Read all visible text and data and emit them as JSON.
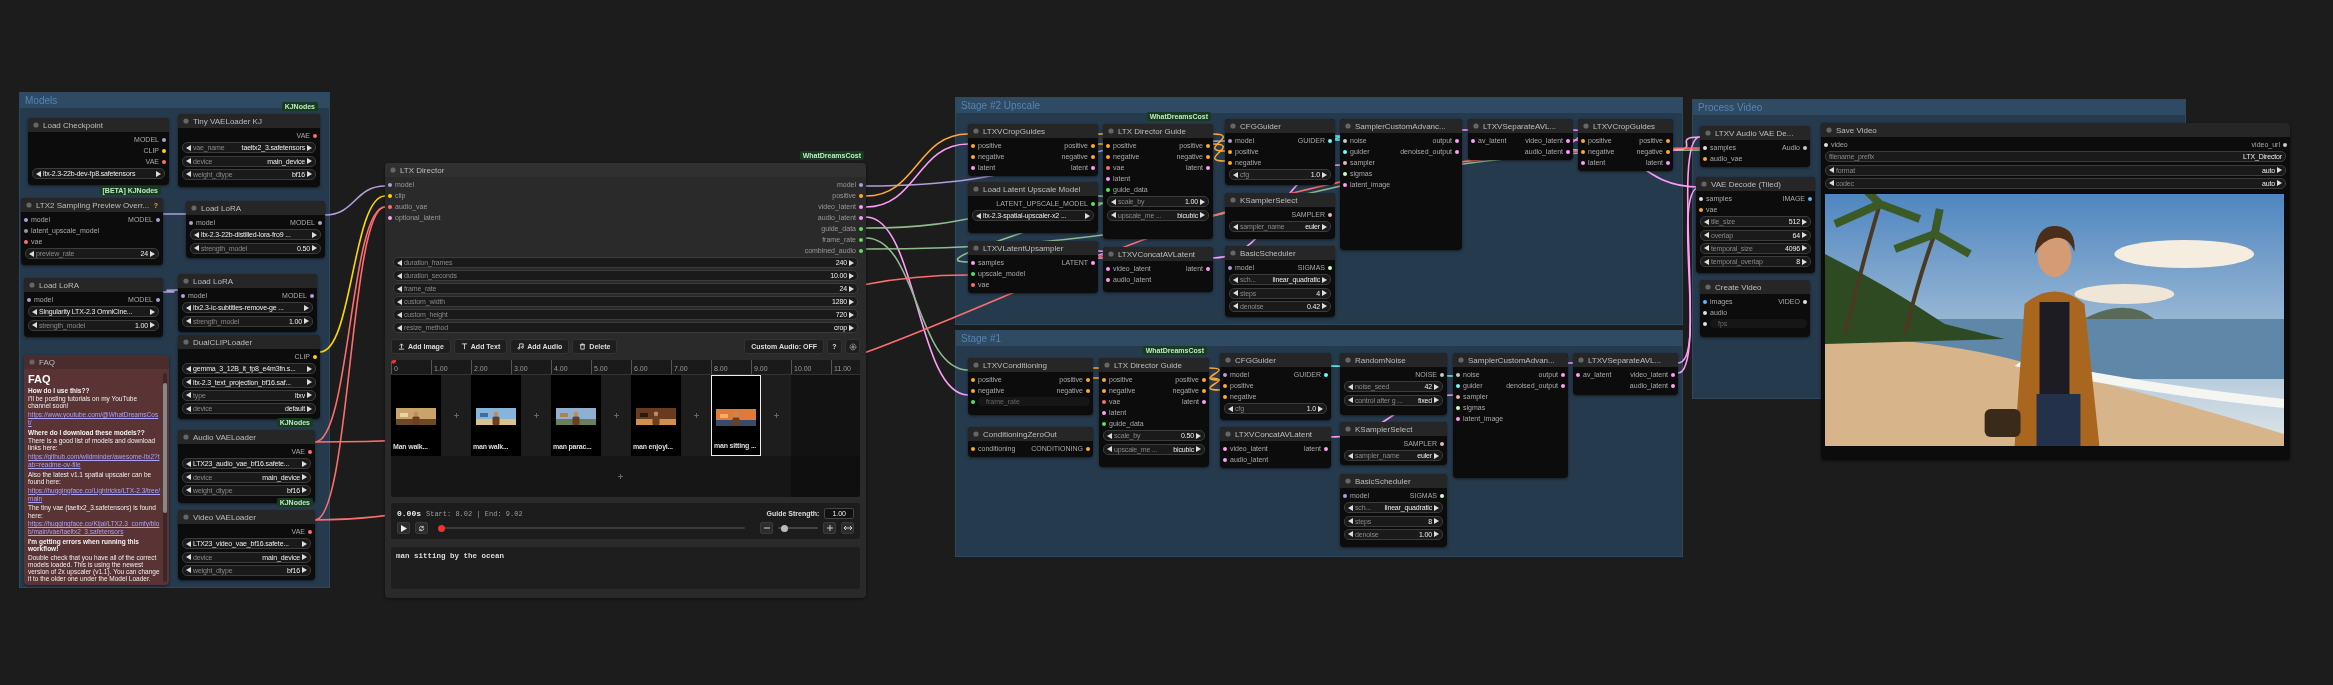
{
  "groups": [
    {
      "title": "Models"
    },
    {
      "title": "Stage #2 Upscale"
    },
    {
      "title": "Stage #1"
    },
    {
      "title": "Process Video"
    }
  ],
  "nodes": [
    {
      "kind": "standard",
      "title": "Load Checkpoint",
      "outputs": [
        {
          "name": "MODEL",
          "color": "#b39ddb"
        },
        {
          "name": "CLIP",
          "color": "#ffd500"
        },
        {
          "name": "VAE",
          "color": "#ff6e6e"
        }
      ],
      "widgets": [
        {
          "kind": "combo",
          "value": "ltx-2.3-22b-dev-fp8.safetensors"
        }
      ]
    },
    {
      "kind": "standard",
      "title": "Tiny VAELoader KJ",
      "badge": "KJNodes",
      "outputs": [
        {
          "name": "VAE",
          "color": "#ff6e6e"
        }
      ],
      "widgets": [
        {
          "kind": "combo",
          "label": "vae_name",
          "value": "taeltx2_3.safetensors"
        },
        {
          "kind": "combo",
          "label": "device",
          "value": "main_device"
        },
        {
          "kind": "combo",
          "label": "weight_dtype",
          "value": "bf16"
        }
      ]
    },
    {
      "kind": "standard",
      "title": "LTX2 Sampling Preview Overr...",
      "badge": "[BETA] KJNodes",
      "help": "?",
      "inputs": [
        {
          "name": "model",
          "color": "#b39ddb"
        },
        {
          "name": "latent_upscale_model",
          "color": "#9a9a9a"
        },
        {
          "name": "vae",
          "color": "#ff6e6e"
        }
      ],
      "outputs": [
        {
          "name": "MODEL",
          "color": "#b39ddb"
        }
      ],
      "widgets": [
        {
          "kind": "combo",
          "label": "preview_rate",
          "value": "24"
        }
      ]
    },
    {
      "kind": "standard",
      "title": "Load LoRA",
      "inputs": [
        {
          "name": "model",
          "color": "#b39ddb"
        }
      ],
      "outputs": [
        {
          "name": "MODEL",
          "color": "#b39ddb"
        }
      ],
      "widgets": [
        {
          "kind": "combo",
          "value": "ltx-2.3-22b-distilled-lora-fro9 ..."
        },
        {
          "kind": "combo",
          "label": "strength_model",
          "value": "0.50"
        }
      ]
    },
    {
      "kind": "standard",
      "title": "Load LoRA",
      "inputs": [
        {
          "name": "model",
          "color": "#b39ddb"
        }
      ],
      "outputs": [
        {
          "name": "MODEL",
          "color": "#b39ddb"
        }
      ],
      "widgets": [
        {
          "kind": "combo",
          "value": "Singularity LTX-2.3  OmniCine..."
        },
        {
          "kind": "combo",
          "label": "strength_model",
          "value": "1.00"
        }
      ]
    },
    {
      "kind": "standard",
      "title": "Load LoRA",
      "inputs": [
        {
          "name": "model",
          "color": "#b39ddb"
        }
      ],
      "outputs": [
        {
          "name": "MODEL",
          "color": "#b39ddb"
        }
      ],
      "widgets": [
        {
          "kind": "combo",
          "value": "ltx2.3-ic-subtitles-remove-ge ..."
        },
        {
          "kind": "combo",
          "label": "strength_model",
          "value": "1.00"
        }
      ]
    },
    {
      "kind": "note",
      "title": "FAQ",
      "paragraphs": [
        {
          "kind": "heading",
          "text": "FAQ"
        },
        {
          "kind": "question",
          "text": "How do I use this??"
        },
        {
          "kind": "text",
          "text": "I'll be posting tutorials on my YouTube channel soon!"
        },
        {
          "kind": "link",
          "text": "https://www.youtube.com/@WhatDreamsCost/"
        },
        {
          "kind": "question",
          "text": "Where do I download these models??"
        },
        {
          "kind": "text",
          "text": "There is a good list of models and download links here:"
        },
        {
          "kind": "link",
          "text": "https://github.com/wildminder/awesome-ltx2?tab=readme-ov-file"
        },
        {
          "kind": "text",
          "text": "Also the latest v1.1 spatial upscaler can be found here:"
        },
        {
          "kind": "link",
          "text": "https://huggingface.co/Lightricks/LTX-2.3/tree/main"
        },
        {
          "kind": "text",
          "text": "The tiny vae (taeltx2_3.safetensors) is found here:"
        },
        {
          "kind": "link",
          "text": "https://huggingface.co/Kijai/LTX2.3_comfy/blob/main/vae/taeltx2_3.safetensors"
        },
        {
          "kind": "question",
          "text": "I'm getting errors when running this workflow!"
        },
        {
          "kind": "text",
          "text": "Double check that you have all of the correct models loaded. This is using the newest version of 2x upscaler (v1.1). You can change it to the older one under the Model Loader."
        }
      ]
    },
    {
      "kind": "standard",
      "title": "DualCLIPLoader",
      "outputs": [
        {
          "name": "CLIP",
          "color": "#ffd500"
        }
      ],
      "widgets": [
        {
          "kind": "combo",
          "value": "gemma_3_12B_it_fp8_e4m3fn.s..."
        },
        {
          "kind": "combo",
          "value": "ltx-2.3_text_projection_bf16.saf..."
        },
        {
          "kind": "combo",
          "label": "type",
          "value": "ltxv"
        },
        {
          "kind": "combo",
          "label": "device",
          "value": "default"
        }
      ]
    },
    {
      "kind": "standard",
      "title": "Audio VAELoader",
      "badge": "KJNodes",
      "outputs": [
        {
          "name": "VAE",
          "color": "#ff6e6e"
        }
      ],
      "widgets": [
        {
          "kind": "combo",
          "value": "LTX23_audio_vae_bf16.safete..."
        },
        {
          "kind": "combo",
          "label": "device",
          "value": "main_device"
        },
        {
          "kind": "combo",
          "label": "weight_dtype",
          "value": "bf16"
        }
      ]
    },
    {
      "kind": "standard",
      "title": "Video VAELoader",
      "badge": "KJNodes",
      "outputs": [
        {
          "name": "VAE",
          "color": "#ff6e6e"
        }
      ],
      "widgets": [
        {
          "kind": "combo",
          "value": "LTX23_video_vae_bf16.safete..."
        },
        {
          "kind": "combo",
          "label": "device",
          "value": "main_device"
        },
        {
          "kind": "combo",
          "label": "weight_dtype",
          "value": "bf16"
        }
      ]
    },
    {
      "kind": "director",
      "title": "LTX Director",
      "badge": "WhatDreamsCost",
      "inputs": [
        {
          "name": "model",
          "color": "#b39ddb"
        },
        {
          "name": "clip",
          "color": "#ffd500"
        },
        {
          "name": "audio_vae",
          "color": "#ff6e6e"
        },
        {
          "name": "optional_latent",
          "color": "#ff9cf9"
        }
      ],
      "outputs": [
        {
          "name": "model",
          "color": "#b39ddb"
        },
        {
          "name": "positive",
          "color": "#ffa931"
        },
        {
          "name": "video_latent",
          "color": "#ff9cf9"
        },
        {
          "name": "audio_latent",
          "color": "#ff9cf9"
        },
        {
          "name": "guide_data",
          "color": "#5ee35e"
        },
        {
          "name": "frame_rate",
          "color": "#5ee35e"
        },
        {
          "name": "combined_audio",
          "color": "#5ee35e"
        }
      ],
      "widgets": [
        {
          "kind": "combo",
          "label": "duration_frames",
          "value": "240"
        },
        {
          "kind": "combo",
          "label": "duration_seconds",
          "value": "10.00"
        },
        {
          "kind": "combo",
          "label": "frame_rate",
          "value": "24"
        },
        {
          "kind": "combo",
          "label": "custom_width",
          "value": "1280"
        },
        {
          "kind": "combo",
          "label": "custom_height",
          "value": "720"
        },
        {
          "kind": "combo",
          "label": "resize_method",
          "value": "crop"
        }
      ],
      "toolbar": [
        {
          "kind": "upload",
          "label": "Add Image"
        },
        {
          "kind": "text",
          "label": "Add Text"
        },
        {
          "kind": "audio",
          "label": "Add Audio"
        },
        {
          "kind": "delete",
          "label": "Delete"
        }
      ],
      "toolbar_right": [
        {
          "kind": "toggle",
          "label": "Custom Audio: OFF"
        },
        {
          "kind": "help",
          "label": "?"
        },
        {
          "kind": "settings"
        }
      ],
      "ticks": [
        "0",
        "1.00",
        "2.00",
        "3.00",
        "4.00",
        "5.00",
        "6.00",
        "7.00",
        "8.00",
        "9.00",
        "10.00",
        "11.00"
      ],
      "clips": [
        {
          "caption": "Man walk...",
          "selected": false
        },
        {
          "caption": "man walk...",
          "selected": false
        },
        {
          "caption": "man parac...",
          "selected": false
        },
        {
          "caption": "man enjoyi...",
          "selected": false
        },
        {
          "caption": "man sitting ...",
          "selected": true
        }
      ],
      "time": "0.00s",
      "range": "Start: 8.02 | End: 9.02",
      "guide_label": "Guide Strength:",
      "guide_value": "1.00",
      "playhead": {
        "level": 0
      },
      "zoom": {
        "level": 0.15
      },
      "prompt": "man sitting by the ocean"
    },
    {
      "kind": "standard",
      "title": "LTXVCropGuides",
      "inputs": [
        {
          "name": "positive",
          "color": "#ffa931"
        },
        {
          "name": "negative",
          "color": "#ffa931"
        },
        {
          "name": "latent",
          "color": "#ff9cf9"
        }
      ],
      "outputs": [
        {
          "name": "positive",
          "color": "#ffa931"
        },
        {
          "name": "negative",
          "color": "#ffa931"
        },
        {
          "name": "latent",
          "color": "#ff9cf9"
        }
      ]
    },
    {
      "kind": "standard",
      "title": "LTX Director Guide",
      "badge": "WhatDreamsCost",
      "inputs": [
        {
          "name": "positive",
          "color": "#ffa931"
        },
        {
          "name": "negative",
          "color": "#ffa931"
        },
        {
          "name": "vae",
          "color": "#ff6e6e"
        },
        {
          "name": "latent",
          "color": "#ff9cf9"
        },
        {
          "name": "guide_data",
          "color": "#5ee35e"
        }
      ],
      "outputs": [
        {
          "name": "positive",
          "color": "#ffa931"
        },
        {
          "name": "negative",
          "color": "#ffa931"
        },
        {
          "name": "latent",
          "color": "#ff9cf9"
        }
      ],
      "widgets": [
        {
          "kind": "combo",
          "label": "scale_by",
          "value": "1.00"
        },
        {
          "kind": "combo",
          "label": "upscale_me ...",
          "value": "bicubic"
        }
      ]
    },
    {
      "kind": "standard",
      "title": "CFGGuider",
      "inputs": [
        {
          "name": "model",
          "color": "#b39ddb"
        },
        {
          "name": "positive",
          "color": "#ffa931"
        },
        {
          "name": "negative",
          "color": "#ffa931"
        }
      ],
      "outputs": [
        {
          "name": "GUIDER",
          "color": "#66ffff"
        }
      ],
      "widgets": [
        {
          "kind": "combo",
          "label": "cfg",
          "value": "1.0"
        }
      ]
    },
    {
      "kind": "standard",
      "title": "SamplerCustomAdvanc...",
      "inputs": [
        {
          "name": "noise",
          "color": "#c8c8c8"
        },
        {
          "name": "guider",
          "color": "#66ffff"
        },
        {
          "name": "sampler",
          "color": "#ecb4b4"
        },
        {
          "name": "sigmas",
          "color": "#cdffcd"
        },
        {
          "name": "latent_image",
          "color": "#ff9cf9"
        }
      ],
      "outputs": [
        {
          "name": "output",
          "color": "#ff9cf9"
        },
        {
          "name": "denoised_output",
          "color": "#ff9cf9"
        }
      ]
    },
    {
      "kind": "standard",
      "title": "LTXVSeparateAVL...",
      "inputs": [
        {
          "name": "av_latent",
          "color": "#ff9cf9"
        }
      ],
      "outputs": [
        {
          "name": "video_latent",
          "color": "#ff9cf9"
        },
        {
          "name": "audio_latent",
          "color": "#ff9cf9"
        }
      ]
    },
    {
      "kind": "standard",
      "title": "LTXVCropGuides",
      "inputs": [
        {
          "name": "positive",
          "color": "#ffa931"
        },
        {
          "name": "negative",
          "color": "#ffa931"
        },
        {
          "name": "latent",
          "color": "#ff9cf9"
        }
      ],
      "outputs": [
        {
          "name": "positive",
          "color": "#ffa931"
        },
        {
          "name": "negative",
          "color": "#ffa931"
        },
        {
          "name": "latent",
          "color": "#ff9cf9"
        }
      ]
    },
    {
      "kind": "standard",
      "title": "Load Latent Upscale Model",
      "outputs": [
        {
          "name": "LATENT_UPSCALE_MODEL",
          "color": "#5ee35e"
        }
      ],
      "widgets": [
        {
          "kind": "combo",
          "value": "ltx-2.3-spatial-upscaler-x2 ..."
        }
      ]
    },
    {
      "kind": "standard",
      "title": "KSamplerSelect",
      "outputs": [
        {
          "name": "SAMPLER",
          "color": "#ecb4b4"
        }
      ],
      "widgets": [
        {
          "kind": "combo",
          "label": "sampler_name",
          "value": "euler"
        }
      ]
    },
    {
      "kind": "standard",
      "title": "LTXVLatentUpsampler",
      "inputs": [
        {
          "name": "samples",
          "color": "#ff9cf9"
        },
        {
          "name": "upscale_model",
          "color": "#5ee35e"
        },
        {
          "name": "vae",
          "color": "#ff6e6e"
        }
      ],
      "outputs": [
        {
          "name": "LATENT",
          "color": "#ff9cf9"
        }
      ]
    },
    {
      "kind": "standard",
      "title": "LTXVConcatAVLatent",
      "inputs": [
        {
          "name": "video_latent",
          "color": "#ff9cf9"
        },
        {
          "name": "audio_latent",
          "color": "#ff9cf9"
        }
      ],
      "outputs": [
        {
          "name": "latent",
          "color": "#ff9cf9"
        }
      ]
    },
    {
      "kind": "standard",
      "title": "BasicScheduler",
      "inputs": [
        {
          "name": "model",
          "color": "#b39ddb"
        }
      ],
      "outputs": [
        {
          "name": "SIGMAS",
          "color": "#cdffcd"
        }
      ],
      "widgets": [
        {
          "kind": "combo",
          "label": "sch...",
          "value": "linear_quadratic"
        },
        {
          "kind": "combo",
          "label": "steps",
          "value": "4"
        },
        {
          "kind": "combo",
          "label": "denoise",
          "value": "0.42"
        }
      ]
    },
    {
      "kind": "standard",
      "title": "LTXVConditioning",
      "inputs": [
        {
          "name": "positive",
          "color": "#ffa931"
        },
        {
          "name": "negative",
          "color": "#ffa931"
        }
      ],
      "outputs": [
        {
          "name": "positive",
          "color": "#ffa931"
        },
        {
          "name": "negative",
          "color": "#ffa931"
        }
      ],
      "field_inputs": [
        {
          "name": "frame_rate",
          "color": "#5ee35e"
        }
      ]
    },
    {
      "kind": "standard",
      "title": "LTX Director Guide",
      "badge": "WhatDreamsCost",
      "inputs": [
        {
          "name": "positive",
          "color": "#ffa931"
        },
        {
          "name": "negative",
          "color": "#ffa931"
        },
        {
          "name": "vae",
          "color": "#ff6e6e"
        },
        {
          "name": "latent",
          "color": "#ff9cf9"
        },
        {
          "name": "guide_data",
          "color": "#5ee35e"
        }
      ],
      "outputs": [
        {
          "name": "positive",
          "color": "#ffa931"
        },
        {
          "name": "negative",
          "color": "#ffa931"
        },
        {
          "name": "latent",
          "color": "#ff9cf9"
        }
      ],
      "widgets": [
        {
          "kind": "combo",
          "label": "scale_by",
          "value": "0.50"
        },
        {
          "kind": "combo",
          "label": "upscale_me ...",
          "value": "bicubic"
        }
      ]
    },
    {
      "kind": "standard",
      "title": "CFGGuider",
      "inputs": [
        {
          "name": "model",
          "color": "#b39ddb"
        },
        {
          "name": "positive",
          "color": "#ffa931"
        },
        {
          "name": "negative",
          "color": "#ffa931"
        }
      ],
      "outputs": [
        {
          "name": "GUIDER",
          "color": "#66ffff"
        }
      ],
      "widgets": [
        {
          "kind": "combo",
          "label": "cfg",
          "value": "1.0"
        }
      ]
    },
    {
      "kind": "standard",
      "title": "RandomNoise",
      "outputs": [
        {
          "name": "NOISE",
          "color": "#c8c8c8"
        }
      ],
      "widgets": [
        {
          "kind": "combo",
          "label": "noise_seed",
          "value": "42"
        },
        {
          "kind": "combo",
          "label": "control after g ...",
          "value": "fixed"
        }
      ]
    },
    {
      "kind": "standard",
      "title": "SamplerCustomAdvan...",
      "inputs": [
        {
          "name": "noise",
          "color": "#c8c8c8"
        },
        {
          "name": "guider",
          "color": "#66ffff"
        },
        {
          "name": "sampler",
          "color": "#ecb4b4"
        },
        {
          "name": "sigmas",
          "color": "#cdffcd"
        },
        {
          "name": "latent_image",
          "color": "#ff9cf9"
        }
      ],
      "outputs": [
        {
          "name": "output",
          "color": "#ff9cf9"
        },
        {
          "name": "denoised_output",
          "color": "#ff9cf9"
        }
      ]
    },
    {
      "kind": "standard",
      "title": "LTXVSeparateAVL...",
      "inputs": [
        {
          "name": "av_latent",
          "color": "#ff9cf9"
        }
      ],
      "outputs": [
        {
          "name": "video_latent",
          "color": "#ff9cf9"
        },
        {
          "name": "audio_latent",
          "color": "#ff9cf9"
        }
      ]
    },
    {
      "kind": "standard",
      "title": "ConditioningZeroOut",
      "inputs": [
        {
          "name": "conditioning",
          "color": "#ffa931"
        }
      ],
      "outputs": [
        {
          "name": "CONDITIONING",
          "color": "#ffa931"
        }
      ]
    },
    {
      "kind": "standard",
      "title": "LTXVConcatAVLatent",
      "inputs": [
        {
          "name": "video_latent",
          "color": "#ff9cf9"
        },
        {
          "name": "audio_latent",
          "color": "#ff9cf9"
        }
      ],
      "outputs": [
        {
          "name": "latent",
          "color": "#ff9cf9"
        }
      ]
    },
    {
      "kind": "standard",
      "title": "KSamplerSelect",
      "outputs": [
        {
          "name": "SAMPLER",
          "color": "#ecb4b4"
        }
      ],
      "widgets": [
        {
          "kind": "combo",
          "label": "sampler_name",
          "value": "euler"
        }
      ]
    },
    {
      "kind": "standard",
      "title": "BasicScheduler",
      "inputs": [
        {
          "name": "model",
          "color": "#b39ddb"
        }
      ],
      "outputs": [
        {
          "name": "SIGMAS",
          "color": "#cdffcd"
        }
      ],
      "widgets": [
        {
          "kind": "combo",
          "label": "sch...",
          "value": "linear_quadratic"
        },
        {
          "kind": "combo",
          "label": "steps",
          "value": "8"
        },
        {
          "kind": "combo",
          "label": "denoise",
          "value": "1.00"
        }
      ]
    },
    {
      "kind": "standard",
      "title": "LTXV Audio VAE De...",
      "inputs": [
        {
          "name": "samples",
          "color": "#e0e0e0"
        },
        {
          "name": "audio_vae",
          "color": "#ffa931"
        }
      ],
      "outputs": [
        {
          "name": "Audio",
          "color": "#c8c8c8"
        }
      ]
    },
    {
      "kind": "standard",
      "title": "VAE Decode (Tiled)",
      "inputs": [
        {
          "name": "samples",
          "color": "#e0e0e0"
        },
        {
          "name": "vae",
          "color": "#ffa931"
        }
      ],
      "outputs": [
        {
          "name": "IMAGE",
          "color": "#64b5f6"
        }
      ],
      "widgets": [
        {
          "kind": "combo",
          "label": "tile_size",
          "value": "512"
        },
        {
          "kind": "combo",
          "label": "overlap",
          "value": "64"
        },
        {
          "kind": "combo",
          "label": "temporal_size",
          "value": "4096"
        },
        {
          "kind": "combo",
          "label": "temporal_overlap",
          "value": "8"
        }
      ]
    },
    {
      "kind": "standard",
      "title": "Create Video",
      "inputs": [
        {
          "name": "images",
          "color": "#64b5f6"
        },
        {
          "name": "audio",
          "color": "#e0e0e0"
        }
      ],
      "outputs": [
        {
          "name": "VIDEO",
          "color": "#e0e0e0"
        }
      ],
      "field_inputs": [
        {
          "name": "fps",
          "color": "#e0e0e0"
        }
      ]
    },
    {
      "kind": "video",
      "title": "Save Video",
      "inputs": [
        {
          "name": "video",
          "color": "#e0e0e0"
        }
      ],
      "outputs": [
        {
          "name": "video_url",
          "color": "#c8c8c8"
        }
      ],
      "widgets": [
        {
          "kind": "text",
          "label": "filename_prefix",
          "value": "LTX_Director"
        },
        {
          "kind": "combo",
          "label": "format",
          "value": "auto"
        },
        {
          "kind": "combo",
          "label": "codec",
          "value": "auto"
        }
      ]
    }
  ]
}
